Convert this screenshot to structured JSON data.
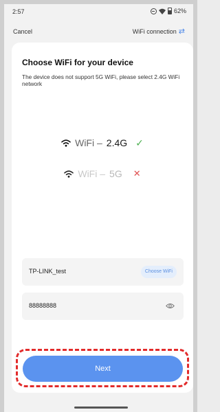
{
  "status_bar": {
    "time": "2:57",
    "battery": "62%",
    "icons": [
      "do-not-disturb-icon",
      "wifi-icon",
      "battery-icon"
    ]
  },
  "nav": {
    "cancel_label": "Cancel",
    "wifi_connection_label": "WiFi connection",
    "swap_icon": "swap-icon"
  },
  "card": {
    "title": "Choose WiFi for your device",
    "description": "The device does not support 5G WiFi, please select 2.4G WiFi network"
  },
  "bands": {
    "supported": {
      "prefix": "WiFi –",
      "band": "2.4G",
      "status_icon": "check-icon"
    },
    "unsupported": {
      "prefix": "WiFi –",
      "band": "5G",
      "status_icon": "cross-icon"
    }
  },
  "form": {
    "ssid_value": "TP-LINK_test",
    "choose_wifi_label": "Choose WiFi",
    "password_value": "88888888",
    "eye_icon": "eye-icon"
  },
  "footer": {
    "next_label": "Next"
  },
  "colors": {
    "accent": "#5b93ef",
    "highlight_outline": "#e22b2b",
    "check": "#4cb050",
    "cross": "#e05050"
  }
}
